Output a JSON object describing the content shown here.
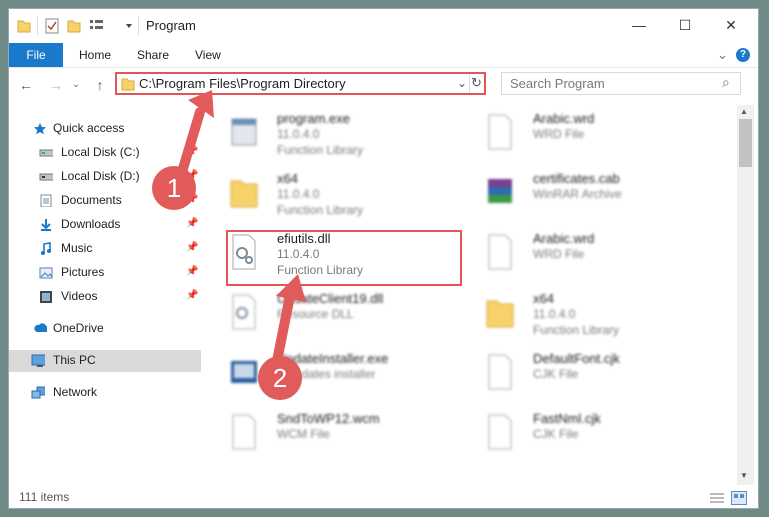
{
  "window": {
    "title": "Program",
    "minimize_glyph": "—",
    "maximize_glyph": "☐",
    "close_glyph": "✕"
  },
  "ribbon": {
    "tabs": [
      "File",
      "Home",
      "Share",
      "View"
    ],
    "expand_glyph": "⌄",
    "help_glyph": "?"
  },
  "nav": {
    "back_glyph": "←",
    "forward_glyph": "→",
    "dropdown_glyph": "⌄",
    "up_glyph": "↑",
    "refresh_glyph": "↻"
  },
  "address": {
    "path": "C:\\Program Files\\Program Directory",
    "dropdown_glyph": "⌄"
  },
  "search": {
    "placeholder": "Search Program",
    "icon_glyph": "⌕"
  },
  "sidebar": {
    "items": [
      {
        "label": "Quick access",
        "icon": "star-icon"
      },
      {
        "label": "Local Disk (C:)",
        "icon": "drive-icon"
      },
      {
        "label": "Local Disk (D:)",
        "icon": "drive-icon"
      },
      {
        "label": "Documents",
        "icon": "documents-icon"
      },
      {
        "label": "Downloads",
        "icon": "download-icon"
      },
      {
        "label": "Music",
        "icon": "music-icon"
      },
      {
        "label": "Pictures",
        "icon": "pictures-icon"
      },
      {
        "label": "Videos",
        "icon": "videos-icon"
      },
      {
        "label": "OneDrive",
        "icon": "cloud-icon"
      },
      {
        "label": "This PC",
        "icon": "computer-icon"
      },
      {
        "label": "Network",
        "icon": "network-icon"
      }
    ]
  },
  "files": [
    {
      "name": "program.exe",
      "version": "11.0.4.0",
      "type": "Function Library",
      "icon": "exe-icon"
    },
    {
      "name": "Arabic.wrd",
      "version": "",
      "type": "WRD File",
      "icon": "file-icon"
    },
    {
      "name": "x64",
      "version": "11.0.4.0",
      "type": "Function Library",
      "icon": "folder-icon"
    },
    {
      "name": "certificates.cab",
      "version": "",
      "type": "WinRAR Archive",
      "icon": "archive-icon"
    },
    {
      "name": "efiutils.dll",
      "version": "11.0.4.0",
      "type": "Function Library",
      "icon": "dll-gear-icon"
    },
    {
      "name": "Arabic.wrd",
      "version": "",
      "type": "WRD File",
      "icon": "file-icon"
    },
    {
      "name": "UpdateClient19.dll",
      "version": "",
      "type": "Resource DLL",
      "icon": "dll-gear-icon"
    },
    {
      "name": "x64",
      "version": "11.0.4.0",
      "type": "Function Library",
      "icon": "folder-icon"
    },
    {
      "name": "UpdateInstaller.exe",
      "version": "",
      "type": "Y updates installer",
      "icon": "installer-icon"
    },
    {
      "name": "DefaultFont.cjk",
      "version": "",
      "type": "CJK File",
      "icon": "file-icon"
    },
    {
      "name": "SndToWP12.wcm",
      "version": "",
      "type": "WCM File",
      "icon": "file-icon"
    },
    {
      "name": "FastNml.cjk",
      "version": "",
      "type": "CJK File",
      "icon": "file-icon"
    }
  ],
  "status": {
    "item_count": "111 items"
  },
  "annotations": {
    "step1": "1",
    "step2": "2",
    "color": "#e15b5b"
  },
  "colors": {
    "accent": "#1979ca",
    "highlight": "#e05656",
    "selected_bg": "#d9d9d9"
  }
}
